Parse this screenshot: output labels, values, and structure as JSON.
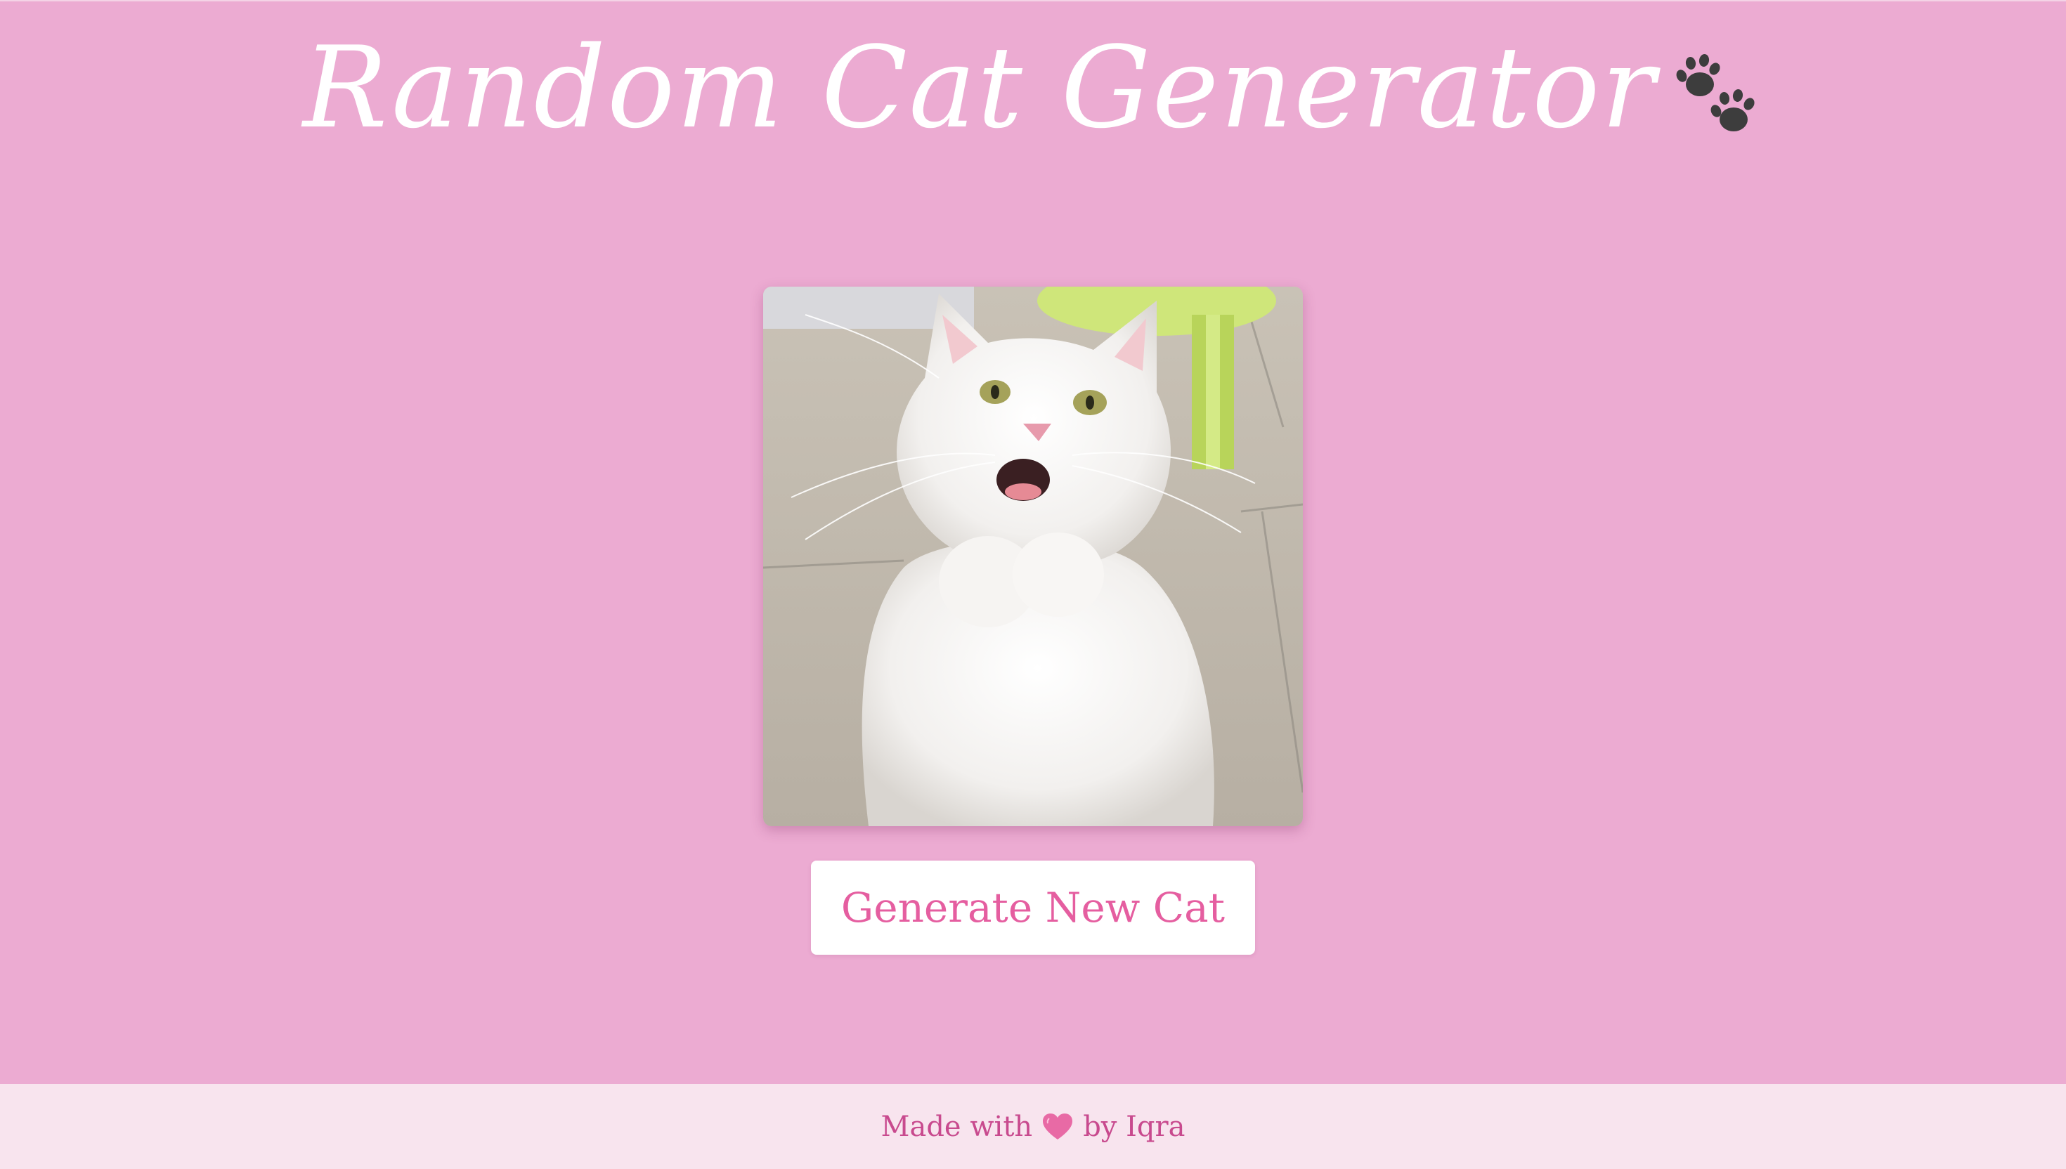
{
  "header": {
    "title": "Random Cat Generator",
    "title_icon": "paw-prints-icon"
  },
  "main": {
    "image_subject": "cat-photo",
    "button_label": "Generate New Cat"
  },
  "footer": {
    "prefix": "Made with",
    "heart_icon": "pink-heart-icon",
    "suffix": "by Iqra"
  },
  "colors": {
    "background": "#ecabd2",
    "footer_background": "#f8e4ee",
    "accent": "#e55ea0",
    "footer_text": "#c84a8e",
    "title": "#ffffff"
  }
}
